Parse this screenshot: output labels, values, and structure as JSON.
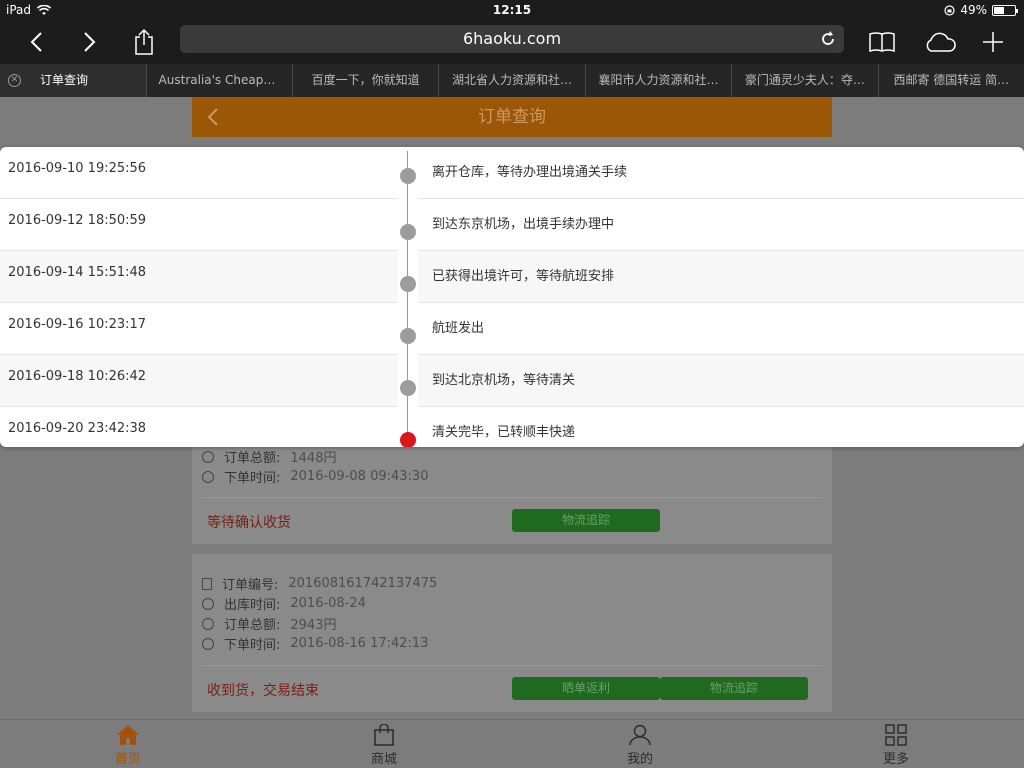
{
  "status_bar": {
    "device": "iPad",
    "time": "12:15",
    "battery": "49%",
    "battery_level": 0.49
  },
  "browser": {
    "url": "6haoku.com",
    "tabs": [
      {
        "label": "订单查询",
        "active": true
      },
      {
        "label": "Australia's Cheape…"
      },
      {
        "label": "百度一下，你就知道"
      },
      {
        "label": "湖北省人力资源和社…"
      },
      {
        "label": "襄阳市人力资源和社…"
      },
      {
        "label": "豪门通灵少夫人：夺…"
      },
      {
        "label": "西邮寄 德国转运 简…"
      }
    ]
  },
  "page": {
    "title": "订单查询",
    "order1": {
      "amount_label": "订单总额:",
      "amount": "1448円",
      "order_time_label": "下单时间:",
      "order_time": "2016-09-08 09:43:30",
      "status": "等待确认收货",
      "track_button": "物流追踪"
    },
    "order2": {
      "order_no_label": "订单编号:",
      "order_no": "201608161742137475",
      "ship_time_label": "出库时间:",
      "ship_time": "2016-08-24",
      "amount_label": "订单总额:",
      "amount": "2943円",
      "order_time_label": "下单时间:",
      "order_time": "2016-08-16 17:42:13",
      "status": "收到货，交易结束",
      "review_button": "晒单返利",
      "track_button": "物流追踪"
    }
  },
  "tracking": [
    {
      "time": "2016-09-10 19:25:56",
      "desc": "离开仓库，等待办理出境通关手续"
    },
    {
      "time": "2016-09-12 18:50:59",
      "desc": "到达东京机场，出境手续办理中"
    },
    {
      "time": "2016-09-14 15:51:48",
      "desc": "已获得出境许可，等待航班安排"
    },
    {
      "time": "2016-09-16 10:23:17",
      "desc": "航班发出"
    },
    {
      "time": "2016-09-18 10:26:42",
      "desc": "到达北京机场，等待清关"
    },
    {
      "time": "2016-09-20 23:42:38",
      "desc": "清关完毕，已转顺丰快递"
    }
  ],
  "bottom_nav": [
    {
      "label": "首页",
      "icon": "home-icon",
      "active": true
    },
    {
      "label": "商城",
      "icon": "shopping-bag-icon"
    },
    {
      "label": "我的",
      "icon": "user-icon"
    },
    {
      "label": "更多",
      "icon": "grid-icon"
    }
  ],
  "colors": {
    "header": "#9b5706",
    "current_dot": "#d8161b",
    "button": "#1f6a1f",
    "active_nav": "#a3520b"
  }
}
